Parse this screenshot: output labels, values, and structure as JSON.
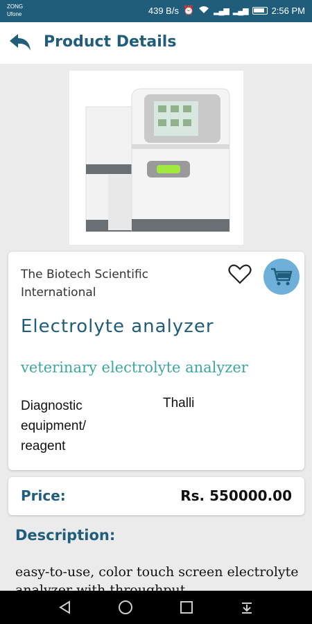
{
  "status_bar": {
    "carrier_1": "ZONG",
    "carrier_2": "Ufone",
    "speed": "439 B/s",
    "time": "2:56 PM"
  },
  "header": {
    "title": "Product Details",
    "back_icon": "back-arrow-icon"
  },
  "product": {
    "seller": "The Biotech Scientific International",
    "name": "Electrolyte analyzer",
    "subtitle": "veterinary electrolyte analyzer",
    "category": "Diagnostic equipment/ reagent",
    "city": "Thalli",
    "price_label": "Price:",
    "price_value": "Rs. 550000.00",
    "description_title": "Description:",
    "description": "easy-to-use, color touch screen electrolyte analyzer with throughput"
  },
  "icons": {
    "favorite": "heart-outline-icon",
    "cart": "cart-icon"
  },
  "colors": {
    "primary": "#1f5d7a",
    "accent": "#3aa6a3",
    "cart_bg": "#6fb0db"
  }
}
